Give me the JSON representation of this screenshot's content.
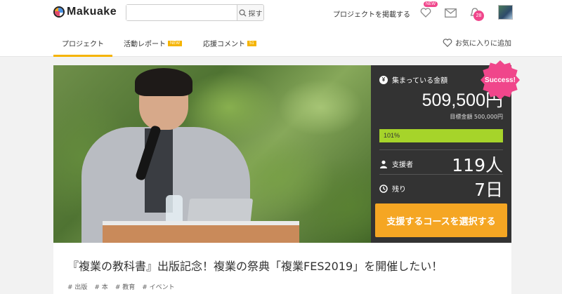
{
  "header": {
    "logo_text": "Makuake",
    "search": {
      "placeholder": "",
      "button_label": "探す"
    },
    "post_project_link": "プロジェクトを掲載する",
    "wishlist_badge": "NEW",
    "notification_count": "28"
  },
  "tabs": {
    "items": [
      {
        "label": "プロジェクト",
        "active": true
      },
      {
        "label": "活動レポート",
        "tag": "NEW"
      },
      {
        "label": "応援コメント",
        "tag": "51"
      }
    ],
    "favorite_label": "お気に入りに追加"
  },
  "funding": {
    "raised_label": "集まっている金額",
    "raised_icon": "¥",
    "raised_amount": "509,500円",
    "goal_text": "目標金額 500,000円",
    "progress_text": "101%",
    "progress_fraction": 1.0,
    "supporters_label": "支援者",
    "supporters_value": "119人",
    "remaining_label": "残り",
    "remaining_value": "7日",
    "cta_label": "支援するコースを選択する",
    "success_badge": "Success!"
  },
  "project": {
    "title": "『複業の教科書』出版記念！複業の祭典「複業FES2019」を開催したい！",
    "tags": [
      "# 出版",
      "# 本",
      "# 教育",
      "# イベント"
    ]
  },
  "colors": {
    "accent": "#f5a623",
    "tab_underline": "#f5b400",
    "badge_pink": "#f0468b",
    "progress_green": "#a6d42a",
    "panel_bg": "#333333"
  },
  "icons": {
    "search": "search-icon",
    "heart": "heart-icon",
    "mail": "mail-icon",
    "bell": "bell-icon",
    "person": "person-icon",
    "clock": "clock-icon",
    "yen": "yen-icon"
  }
}
